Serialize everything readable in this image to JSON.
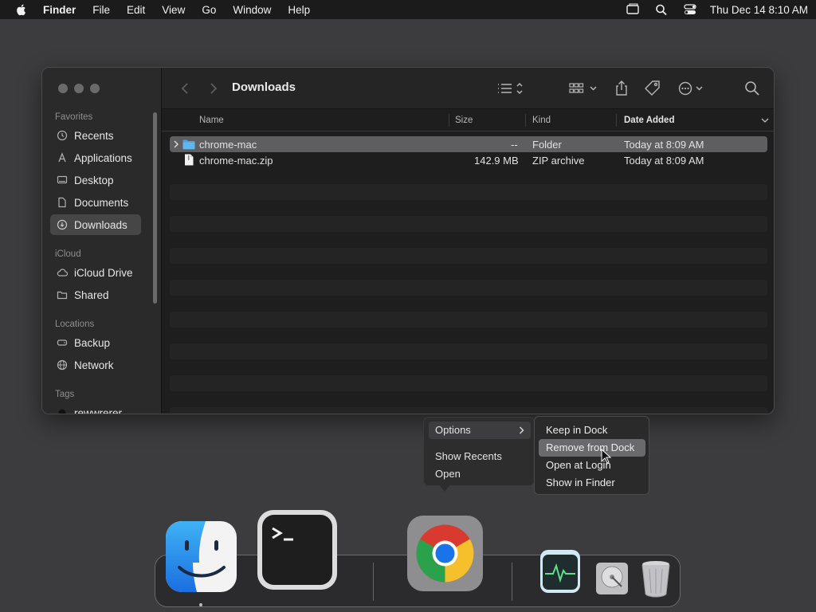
{
  "menubar": {
    "app": "Finder",
    "items": [
      "File",
      "Edit",
      "View",
      "Go",
      "Window",
      "Help"
    ],
    "clock": "Thu Dec 14  8:10 AM"
  },
  "window": {
    "title": "Downloads",
    "sidebar": {
      "favorites_label": "Favorites",
      "favorites": [
        "Recents",
        "Applications",
        "Desktop",
        "Documents",
        "Downloads"
      ],
      "icloud_label": "iCloud",
      "icloud": [
        "iCloud Drive",
        "Shared"
      ],
      "locations_label": "Locations",
      "locations": [
        "Backup",
        "Network"
      ],
      "tags_label": "Tags",
      "tags": [
        "rewwrerer"
      ]
    },
    "columns": {
      "name": "Name",
      "size": "Size",
      "kind": "Kind",
      "date_added": "Date Added"
    },
    "files": [
      {
        "name": "chrome-mac",
        "size": "--",
        "kind": "Folder",
        "date_added": "Today at 8:09 AM"
      },
      {
        "name": "chrome-mac.zip",
        "size": "142.9 MB",
        "kind": "ZIP archive",
        "date_added": "Today at 8:09 AM"
      }
    ]
  },
  "context_menu": {
    "items": [
      "Options",
      "Show Recents",
      "Open"
    ]
  },
  "submenu": {
    "items": [
      "Keep in Dock",
      "Remove from Dock",
      "Open at Login",
      "Show in Finder"
    ]
  },
  "dock": {
    "apps": [
      "finder-icon",
      "terminal-icon",
      "chrome-icon",
      "activity-monitor-icon",
      "disk-utility-icon",
      "trash-icon"
    ]
  },
  "colors": {
    "selection": "#5e5e60",
    "folder": "#4aa3e0"
  }
}
